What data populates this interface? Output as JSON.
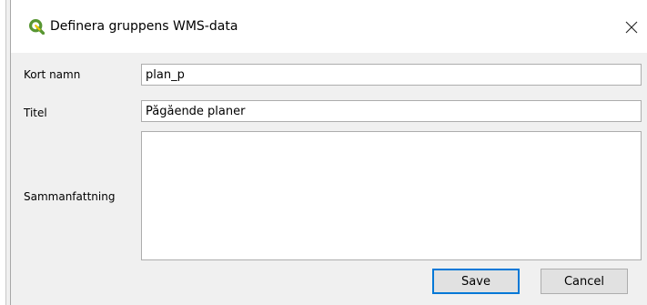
{
  "dialog": {
    "title": "Definera gruppens WMS-data",
    "app_icon": "qgis-logo-icon",
    "close_icon": "close-icon"
  },
  "form": {
    "short_name": {
      "label": "Kort namn",
      "value": "plan_p"
    },
    "title": {
      "label": "Titel",
      "value": "Pågående planer"
    },
    "abstract": {
      "label": "Sammanfattning",
      "value": ""
    }
  },
  "buttons": {
    "save": "Save",
    "cancel": "Cancel"
  },
  "colors": {
    "accent": "#0078d7",
    "qgis_green": "#589632",
    "qgis_yellow": "#eec900"
  }
}
